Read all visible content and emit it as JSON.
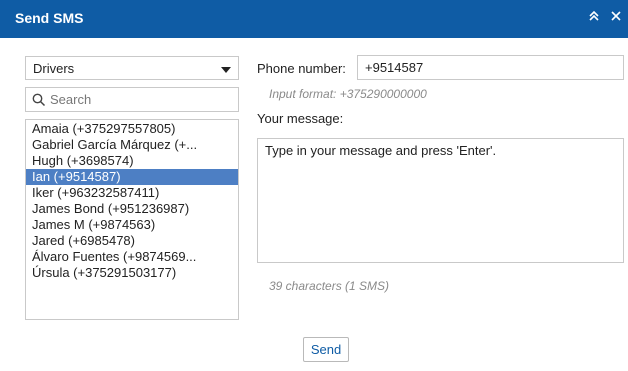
{
  "window": {
    "title": "Send SMS",
    "collapse_icon": "double-chevron-up-icon",
    "close_icon": "close-icon"
  },
  "recipients": {
    "group_select": {
      "value": "Drivers",
      "icon": "dropdown-caret-icon"
    },
    "search": {
      "placeholder": "Search",
      "icon": "search-icon"
    },
    "items": [
      "Amaia (+375297557805)",
      "Gabriel García Márquez (+...",
      "Hugh (+3698574)",
      "Ian (+9514587)",
      "Iker (+963232587411)",
      "James Bond (+951236987)",
      "James M (+9874563)",
      "Jared (+6985478)",
      "Álvaro Fuentes (+9874569...",
      "Úrsula (+375291503177)"
    ],
    "selected": "Ian (+9514587)"
  },
  "form": {
    "phone_label": "Phone number:",
    "phone_value": "+9514587",
    "phone_hint": "Input format: +375290000000",
    "message_label": "Your message:",
    "message_placeholder": "Type in your message and press 'Enter'.",
    "char_count": "39 characters (1 SMS)"
  },
  "actions": {
    "send_label": "Send"
  },
  "colors": {
    "titlebar": "#0f5ca5",
    "selection": "#4d7fc4",
    "hint": "#8a8a8a"
  }
}
